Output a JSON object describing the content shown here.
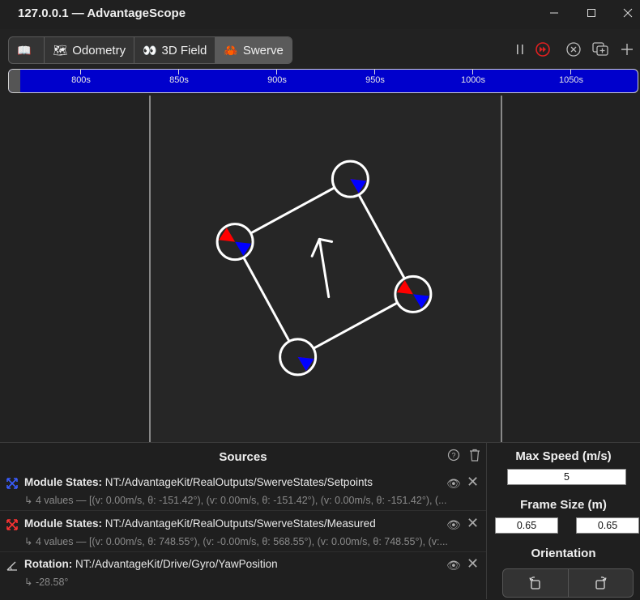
{
  "window": {
    "title": "127.0.0.1 — AdvantageScope"
  },
  "tabs": [
    {
      "label": "",
      "icon": "book-icon"
    },
    {
      "label": "Odometry",
      "icon": "map-icon"
    },
    {
      "label": "3D Field",
      "icon": "glasses-icon"
    },
    {
      "label": "Swerve",
      "icon": "crab-icon",
      "active": true
    }
  ],
  "timeline": {
    "ticks": [
      "800s",
      "850s",
      "900s",
      "950s",
      "1000s",
      "1050s"
    ],
    "accent": "#0000cc"
  },
  "sources": {
    "title": "Sources",
    "items": [
      {
        "label": "Module States:",
        "key": "NT:/AdvantageKit/RealOutputs/SwerveStates/Setpoints",
        "detail": "↳ 4 values — [(v: 0.00m/s, θ: -151.42°), (v: 0.00m/s, θ: -151.42°), (v: 0.00m/s, θ: -151.42°), (...",
        "icon": "module-states-icon",
        "color": "#3a5cff"
      },
      {
        "label": "Module States:",
        "key": "NT:/AdvantageKit/RealOutputs/SwerveStates/Measured",
        "detail": "↳ 4 values — [(v: 0.00m/s, θ: 748.55°), (v: -0.00m/s, θ: 568.55°), (v: 0.00m/s, θ: 748.55°), (v:...",
        "icon": "module-states-icon",
        "color": "#ff3333"
      },
      {
        "label": "Rotation:",
        "key": "NT:/AdvantageKit/Drive/Gyro/YawPosition",
        "detail": "↳ -28.58°",
        "icon": "rotation-icon",
        "color": "#cccccc"
      }
    ]
  },
  "settings": {
    "max_speed_label": "Max Speed (m/s)",
    "max_speed_value": "5",
    "frame_size_label": "Frame Size (m)",
    "frame_width": "0.65",
    "frame_length": "0.65",
    "orientation_label": "Orientation"
  },
  "robot": {
    "rotation_deg": -28.58,
    "modules": [
      {
        "setpoint_angle_deg": -151.42,
        "measured_angle_deg": 748.55
      },
      {
        "setpoint_angle_deg": -151.42,
        "measured_angle_deg": 568.55
      },
      {
        "setpoint_angle_deg": -151.42,
        "measured_angle_deg": 748.55
      },
      {
        "setpoint_angle_deg": -151.42,
        "measured_angle_deg": 568.55
      }
    ],
    "colors": {
      "setpoint": "#0000ff",
      "measured": "#ff0000",
      "frame": "#ffffff"
    }
  }
}
